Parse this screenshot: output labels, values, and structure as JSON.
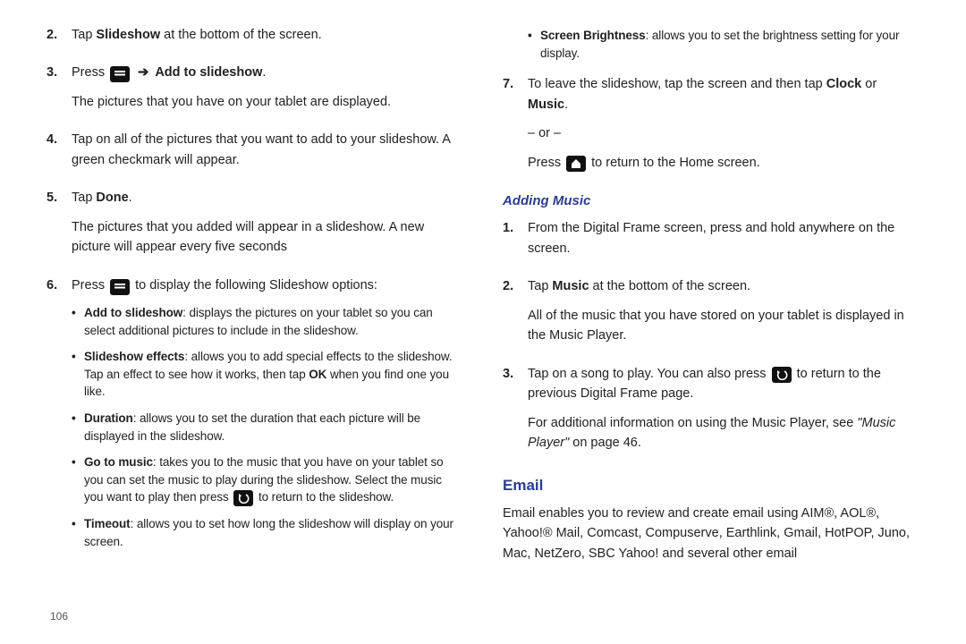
{
  "pageNumber": "106",
  "left": {
    "step2": {
      "num": "2.",
      "pre": "Tap ",
      "bold": "Slideshow",
      "post": " at the bottom of the screen."
    },
    "step3": {
      "num": "3.",
      "pre": "Press ",
      "boldPost": "Add to slideshow",
      "period": ".",
      "para2": "The pictures that you have on your tablet are displayed."
    },
    "step4": {
      "num": "4.",
      "text": "Tap on all of the pictures that you want to add to your slideshow. A green checkmark will appear."
    },
    "step5": {
      "num": "5.",
      "pre": "Tap ",
      "bold": "Done",
      "period": ".",
      "para2": "The pictures that you added will appear in a slideshow. A new picture will appear every five seconds"
    },
    "step6": {
      "num": "6.",
      "pre": "Press ",
      "post": " to display the following Slideshow options:",
      "bullets": {
        "b1": {
          "bold": "Add to slideshow",
          "rest": ": displays the pictures on your tablet so you can select additional pictures to include in the slideshow."
        },
        "b2": {
          "bold": "Slideshow effects",
          "rest1": ": allows you to add special effects to the slideshow. Tap an effect to see how it works, then tap ",
          "ok": "OK",
          "rest2": " when you find one you like."
        },
        "b3": {
          "bold": "Duration",
          "rest": ": allows you to set the duration that each picture will be displayed in the slideshow."
        },
        "b4": {
          "bold": "Go to music",
          "rest1": ": takes you to the music that you have on your tablet so you can set the music to play during the slideshow. Select the music you want to play then press ",
          "rest2": " to return to the slideshow."
        },
        "b5": {
          "bold": "Timeout",
          "rest": ": allows you to set how long the slideshow will display on your screen."
        }
      }
    }
  },
  "right": {
    "topBullet": {
      "bold": "Screen Brightness",
      "rest": ": allows you to set the brightness setting for your display."
    },
    "step7": {
      "num": "7.",
      "line1a": "To leave the slideshow, tap the screen and then tap ",
      "clock": "Clock",
      "line1b": " or ",
      "music": "Music",
      "period": ".",
      "or": "– or –",
      "line2a": "Press ",
      "line2b": " to return to the Home screen."
    },
    "addingMusic": {
      "heading": "Adding Music",
      "s1": {
        "num": "1.",
        "text": "From the Digital Frame screen, press and hold anywhere on the screen."
      },
      "s2": {
        "num": "2.",
        "pre": "Tap ",
        "bold": "Music",
        "post": " at the bottom of the screen.",
        "para2": "All of the music that you have stored on your tablet is displayed in the Music Player."
      },
      "s3": {
        "num": "3.",
        "pre": "Tap on a song to play. You can also press ",
        "post": " to return to the previous Digital Frame page.",
        "para2a": "For additional information on using the Music Player, see ",
        "ref": "\"Music Player\"",
        "para2b": " on page 46."
      }
    },
    "email": {
      "heading": "Email",
      "body": "Email enables you to review and create email using AIM®, AOL®, Yahoo!® Mail, Comcast, Compuserve, Earthlink, Gmail, HotPOP, Juno, Mac, NetZero, SBC Yahoo! and several other email"
    }
  }
}
